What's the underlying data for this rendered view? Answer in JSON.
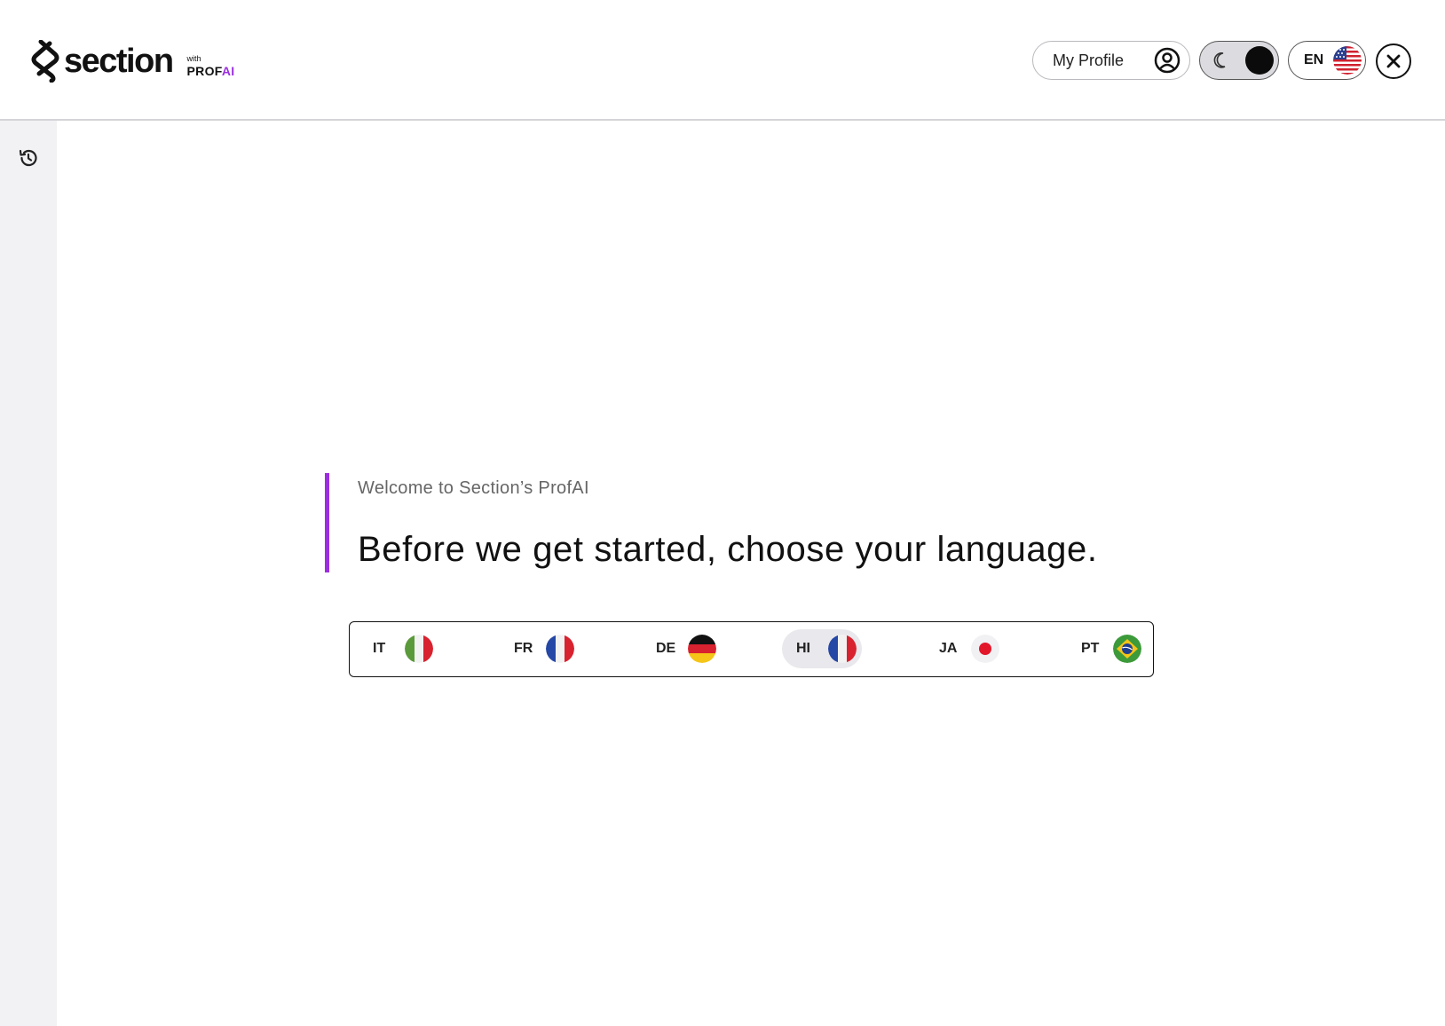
{
  "header": {
    "logo": {
      "word": "section",
      "with": "with",
      "prof": "PROF",
      "ai": "AI"
    },
    "profile_label": "My Profile",
    "current_language": "EN"
  },
  "main": {
    "welcome": "Welcome to Section’s ProfAI",
    "headline": "Before we get started, choose your language."
  },
  "languages": [
    {
      "code": "IT",
      "flag": "italy-flag-icon",
      "selected": false
    },
    {
      "code": "FR",
      "flag": "france-flag-icon",
      "selected": false
    },
    {
      "code": "DE",
      "flag": "germany-flag-icon",
      "selected": false
    },
    {
      "code": "HI",
      "flag": "france-flag-icon",
      "selected": true
    },
    {
      "code": "JA",
      "flag": "japan-flag-icon",
      "selected": false
    },
    {
      "code": "PT",
      "flag": "brazil-flag-icon",
      "selected": false
    }
  ],
  "colors": {
    "accent": "#9b2fe0",
    "sidebar": "#f2f1f3",
    "selected": "#e9e8ec"
  }
}
